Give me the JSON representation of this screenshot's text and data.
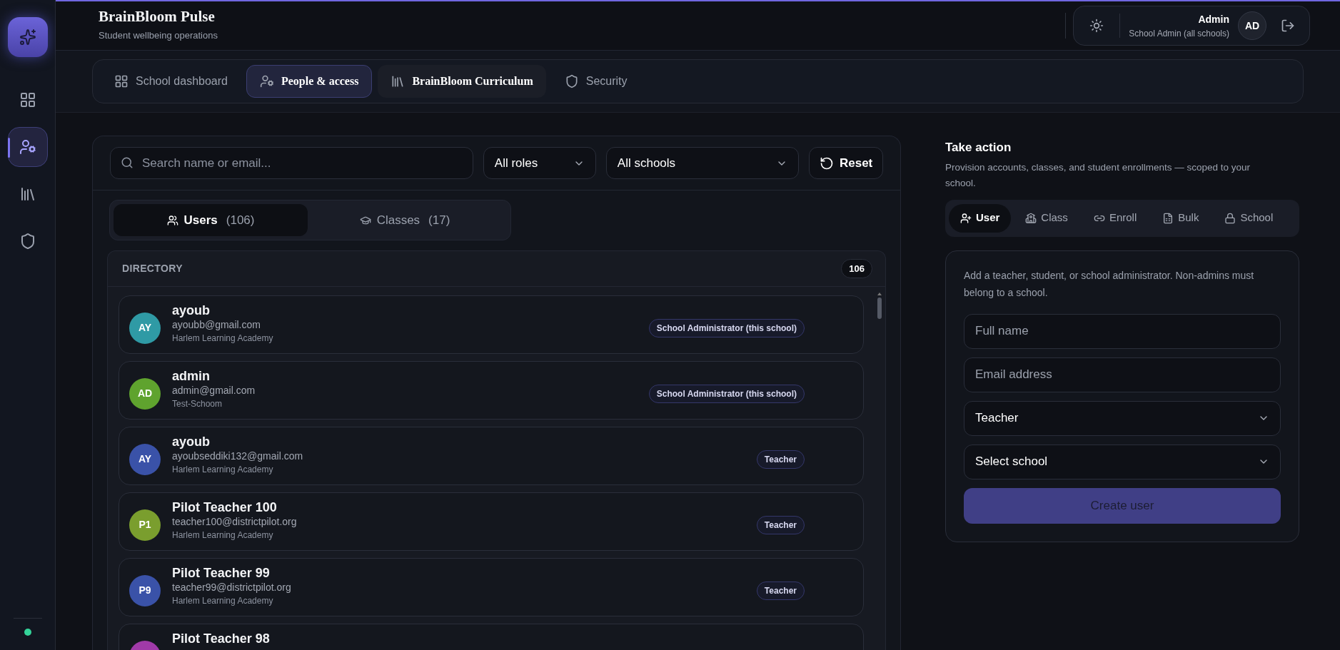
{
  "sidebar": {
    "items": [
      {
        "kind": "grid",
        "selected": false
      },
      {
        "kind": "user-cog",
        "selected": true
      },
      {
        "kind": "library",
        "selected": false
      },
      {
        "kind": "shield",
        "selected": false
      }
    ],
    "status_online": true
  },
  "header": {
    "title": "BrainBloom Pulse",
    "subtitle": "Student wellbeing operations",
    "user": {
      "name": "Admin",
      "role": "School Admin (all schools)",
      "initials": "AD"
    }
  },
  "nav_tabs": [
    {
      "label": "School dashboard",
      "kind": "grid",
      "selected": false,
      "featured": false
    },
    {
      "label": "People & access",
      "kind": "user-cog",
      "selected": true,
      "featured": true
    },
    {
      "label": "BrainBloom Curriculum",
      "kind": "library",
      "selected": false,
      "featured": true
    },
    {
      "label": "Security",
      "kind": "shield",
      "selected": false,
      "featured": false
    }
  ],
  "filters": {
    "search": {
      "placeholder": "Search name or email..."
    },
    "role": "All roles",
    "school": "All schools",
    "reset": "Reset"
  },
  "view_tabs": [
    {
      "label": "Users",
      "count": "(106)",
      "kind": "users",
      "selected": true
    },
    {
      "label": "Classes",
      "count": "(17)",
      "kind": "cap",
      "selected": false
    }
  ],
  "directory": {
    "title": "DIRECTORY",
    "count": "106",
    "users": [
      {
        "initials": "AY",
        "color": "#2f9aa5",
        "name": "ayoub",
        "email": "ayoubb@gmail.com",
        "school": "Harlem Learning Academy",
        "role": "School Administrator (this school)"
      },
      {
        "initials": "AD",
        "color": "#5fa32e",
        "name": "admin",
        "email": "admin@gmail.com",
        "school": "Test-Schoom",
        "role": "School Administrator (this school)"
      },
      {
        "initials": "AY",
        "color": "#3a52a8",
        "name": "ayoub",
        "email": "ayoubseddiki132@gmail.com",
        "school": "Harlem Learning Academy",
        "role": "Teacher"
      },
      {
        "initials": "P1",
        "color": "#7a9e2e",
        "name": "Pilot Teacher 100",
        "email": "teacher100@districtpilot.org",
        "school": "Harlem Learning Academy",
        "role": "Teacher"
      },
      {
        "initials": "P9",
        "color": "#3a52a8",
        "name": "Pilot Teacher 99",
        "email": "teacher99@districtpilot.org",
        "school": "Harlem Learning Academy",
        "role": "Teacher"
      },
      {
        "color": "#a03aa8",
        "name": "Pilot Teacher 98"
      }
    ]
  },
  "action": {
    "title": "Take action",
    "description": "Provision accounts, classes, and student enrollments — scoped to your school.",
    "tabs": [
      {
        "label": "User",
        "kind": "user-plus",
        "selected": true
      },
      {
        "label": "Class",
        "kind": "school",
        "selected": false
      },
      {
        "label": "Enroll",
        "kind": "link",
        "selected": false
      },
      {
        "label": "Bulk",
        "kind": "file",
        "selected": false
      },
      {
        "label": "School",
        "kind": "lock",
        "selected": false
      }
    ],
    "form": {
      "description": "Add a teacher, student, or school administrator. Non-admins must belong to a school.",
      "name": {
        "placeholder": "Full name"
      },
      "email": {
        "placeholder": "Email address"
      },
      "role": "Teacher",
      "school": "Select school",
      "submit": "Create user"
    }
  }
}
